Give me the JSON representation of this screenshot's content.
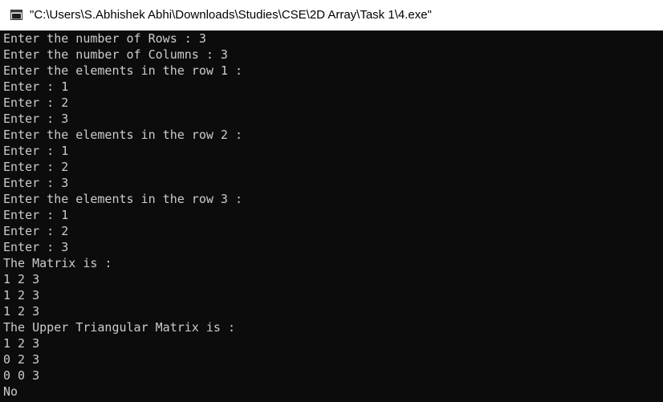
{
  "window": {
    "title": "\"C:\\Users\\S.Abhishek Abhi\\Downloads\\Studies\\CSE\\2D Array\\Task 1\\4.exe\"",
    "app_icon": "console-window-icon"
  },
  "console": {
    "lines": [
      "Enter the number of Rows : 3",
      "Enter the number of Columns : 3",
      "Enter the elements in the row 1 :",
      "Enter : 1",
      "Enter : 2",
      "Enter : 3",
      "Enter the elements in the row 2 :",
      "Enter : 1",
      "Enter : 2",
      "Enter : 3",
      "Enter the elements in the row 3 :",
      "Enter : 1",
      "Enter : 2",
      "Enter : 3",
      "The Matrix is :",
      "1 2 3",
      "1 2 3",
      "1 2 3",
      "The Upper Triangular Matrix is :",
      "1 2 3",
      "0 2 3",
      "0 0 3",
      "No"
    ]
  }
}
